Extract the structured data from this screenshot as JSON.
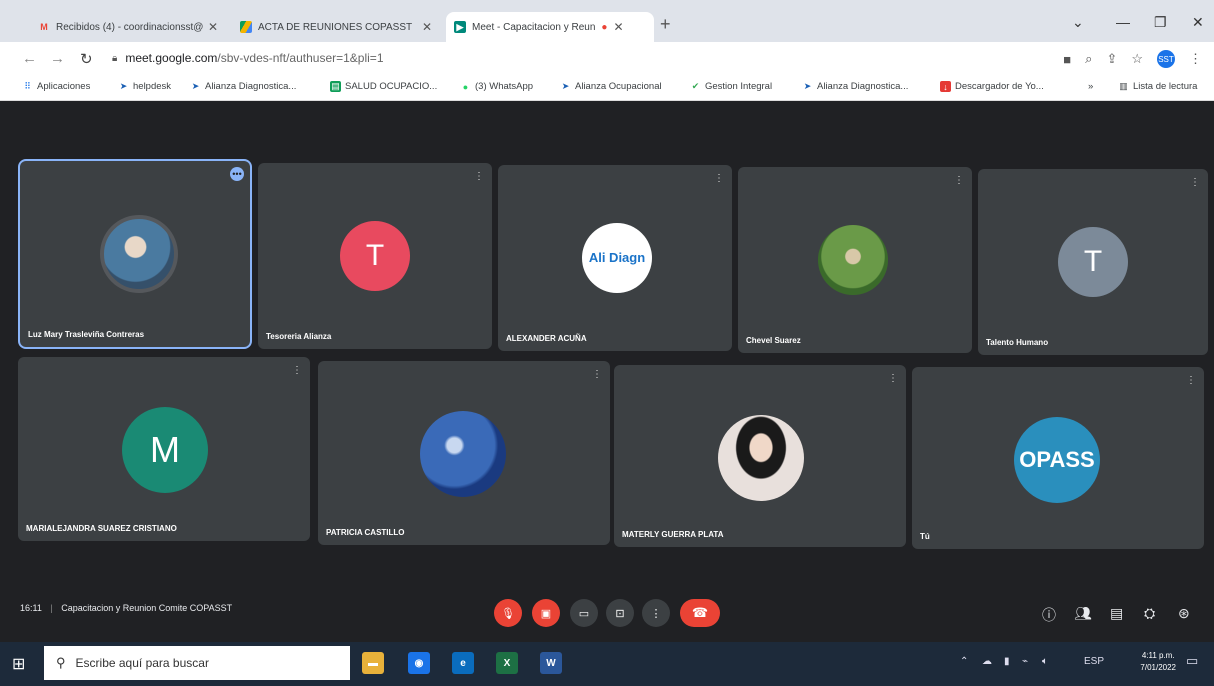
{
  "browser": {
    "tabs": [
      {
        "label": "Recibidos (4) - coordinacionsst@",
        "icon": "gmail-icon"
      },
      {
        "label": "ACTA DE REUNIONES COPASST",
        "icon": "drive-icon"
      },
      {
        "label": "Meet - Capacitacion y Reun",
        "icon": "meet-icon"
      }
    ],
    "url_host": "meet.google.com",
    "url_path": "/sbv-vdes-nft/authuser=1&pli=1",
    "bookmarks": [
      {
        "label": "Aplicaciones",
        "icon": "apps-grid-icon"
      },
      {
        "label": "helpdesk",
        "icon": "bird-icon"
      },
      {
        "label": "Alianza Diagnostica...",
        "icon": "bird-icon"
      },
      {
        "label": "SALUD OCUPACIO...",
        "icon": "sheets-icon"
      },
      {
        "label": "(3) WhatsApp",
        "icon": "whatsapp-icon"
      },
      {
        "label": "Alianza Ocupacional",
        "icon": "bird-icon"
      },
      {
        "label": "Gestion Integral",
        "icon": "check-icon"
      },
      {
        "label": "Alianza Diagnostica...",
        "icon": "bird-icon"
      },
      {
        "label": "Descargador de Yo...",
        "icon": "download-icon"
      }
    ],
    "reading_list": "Lista de lectura",
    "profile_initials": "SST"
  },
  "meet": {
    "participants": [
      {
        "name": "Luz Mary Trasleviña Contreras",
        "avatar": "photo",
        "color": "#6b8fa8"
      },
      {
        "name": "Tesoreria Alianza",
        "avatar": "T",
        "color": "#e84a5f"
      },
      {
        "name": "ALEXANDER ACUÑA",
        "avatar": "logo",
        "color": "#ffffff",
        "logo_text": "Ali Diagn"
      },
      {
        "name": "Chevel Suarez",
        "avatar": "photo",
        "color": "#5a8a3a"
      },
      {
        "name": "Talento Humano",
        "avatar": "T",
        "color": "#7c8a99"
      },
      {
        "name": "MARIALEJANDRA SUAREZ CRISTIANO",
        "avatar": "M",
        "color": "#1a8a74"
      },
      {
        "name": "PATRICIA CASTILLO",
        "avatar": "photo",
        "color": "#2e5fa8"
      },
      {
        "name": "MATERLY GUERRA PLATA",
        "avatar": "photo",
        "color": "#d8c8c0"
      },
      {
        "name": "Tú",
        "avatar": "logo",
        "color": "#2a8fbd",
        "logo_text": "OPASS"
      }
    ],
    "meeting_time": "16:11",
    "meeting_title": "Capacitacion y Reunion Comite COPASST"
  },
  "taskbar": {
    "search_placeholder": "Escribe aquí para buscar",
    "lang": "ESP",
    "time": "4:11 p.m.",
    "date": "7/01/2022"
  }
}
